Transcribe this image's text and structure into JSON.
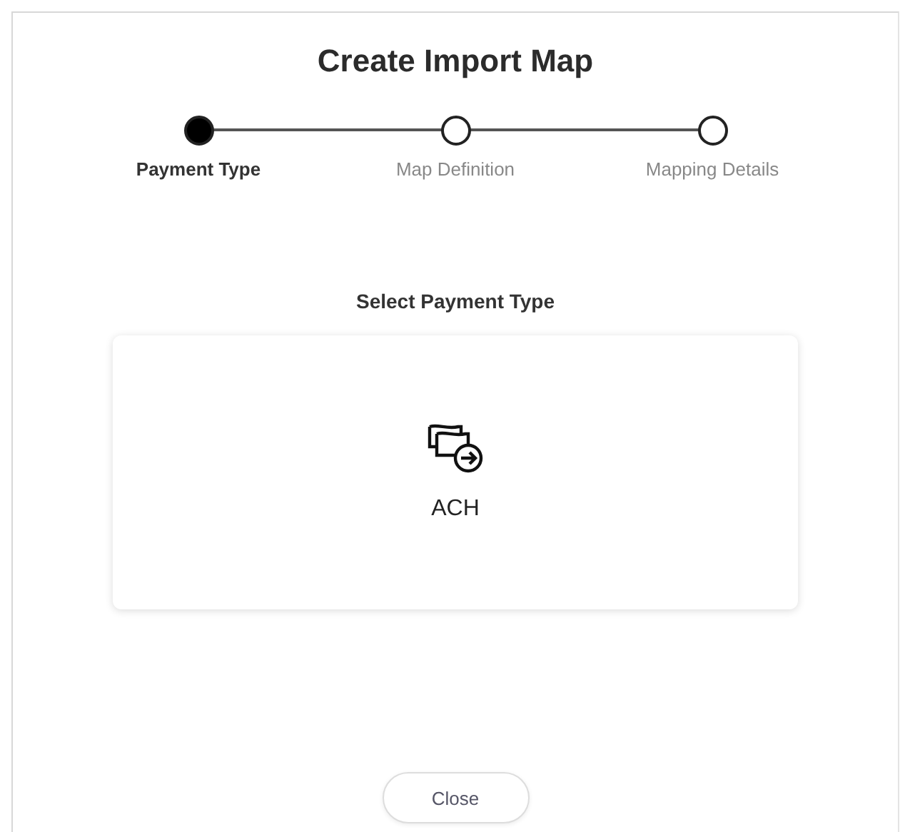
{
  "dialog": {
    "title": "Create Import Map"
  },
  "steps": [
    {
      "label": "Payment Type",
      "selected": true
    },
    {
      "label": "Map Definition",
      "selected": false
    },
    {
      "label": "Mapping Details",
      "selected": false
    }
  ],
  "prompt": "Select Payment Type",
  "payment_types": [
    {
      "label": "ACH"
    }
  ],
  "buttons": [
    {
      "label": "Close"
    }
  ]
}
